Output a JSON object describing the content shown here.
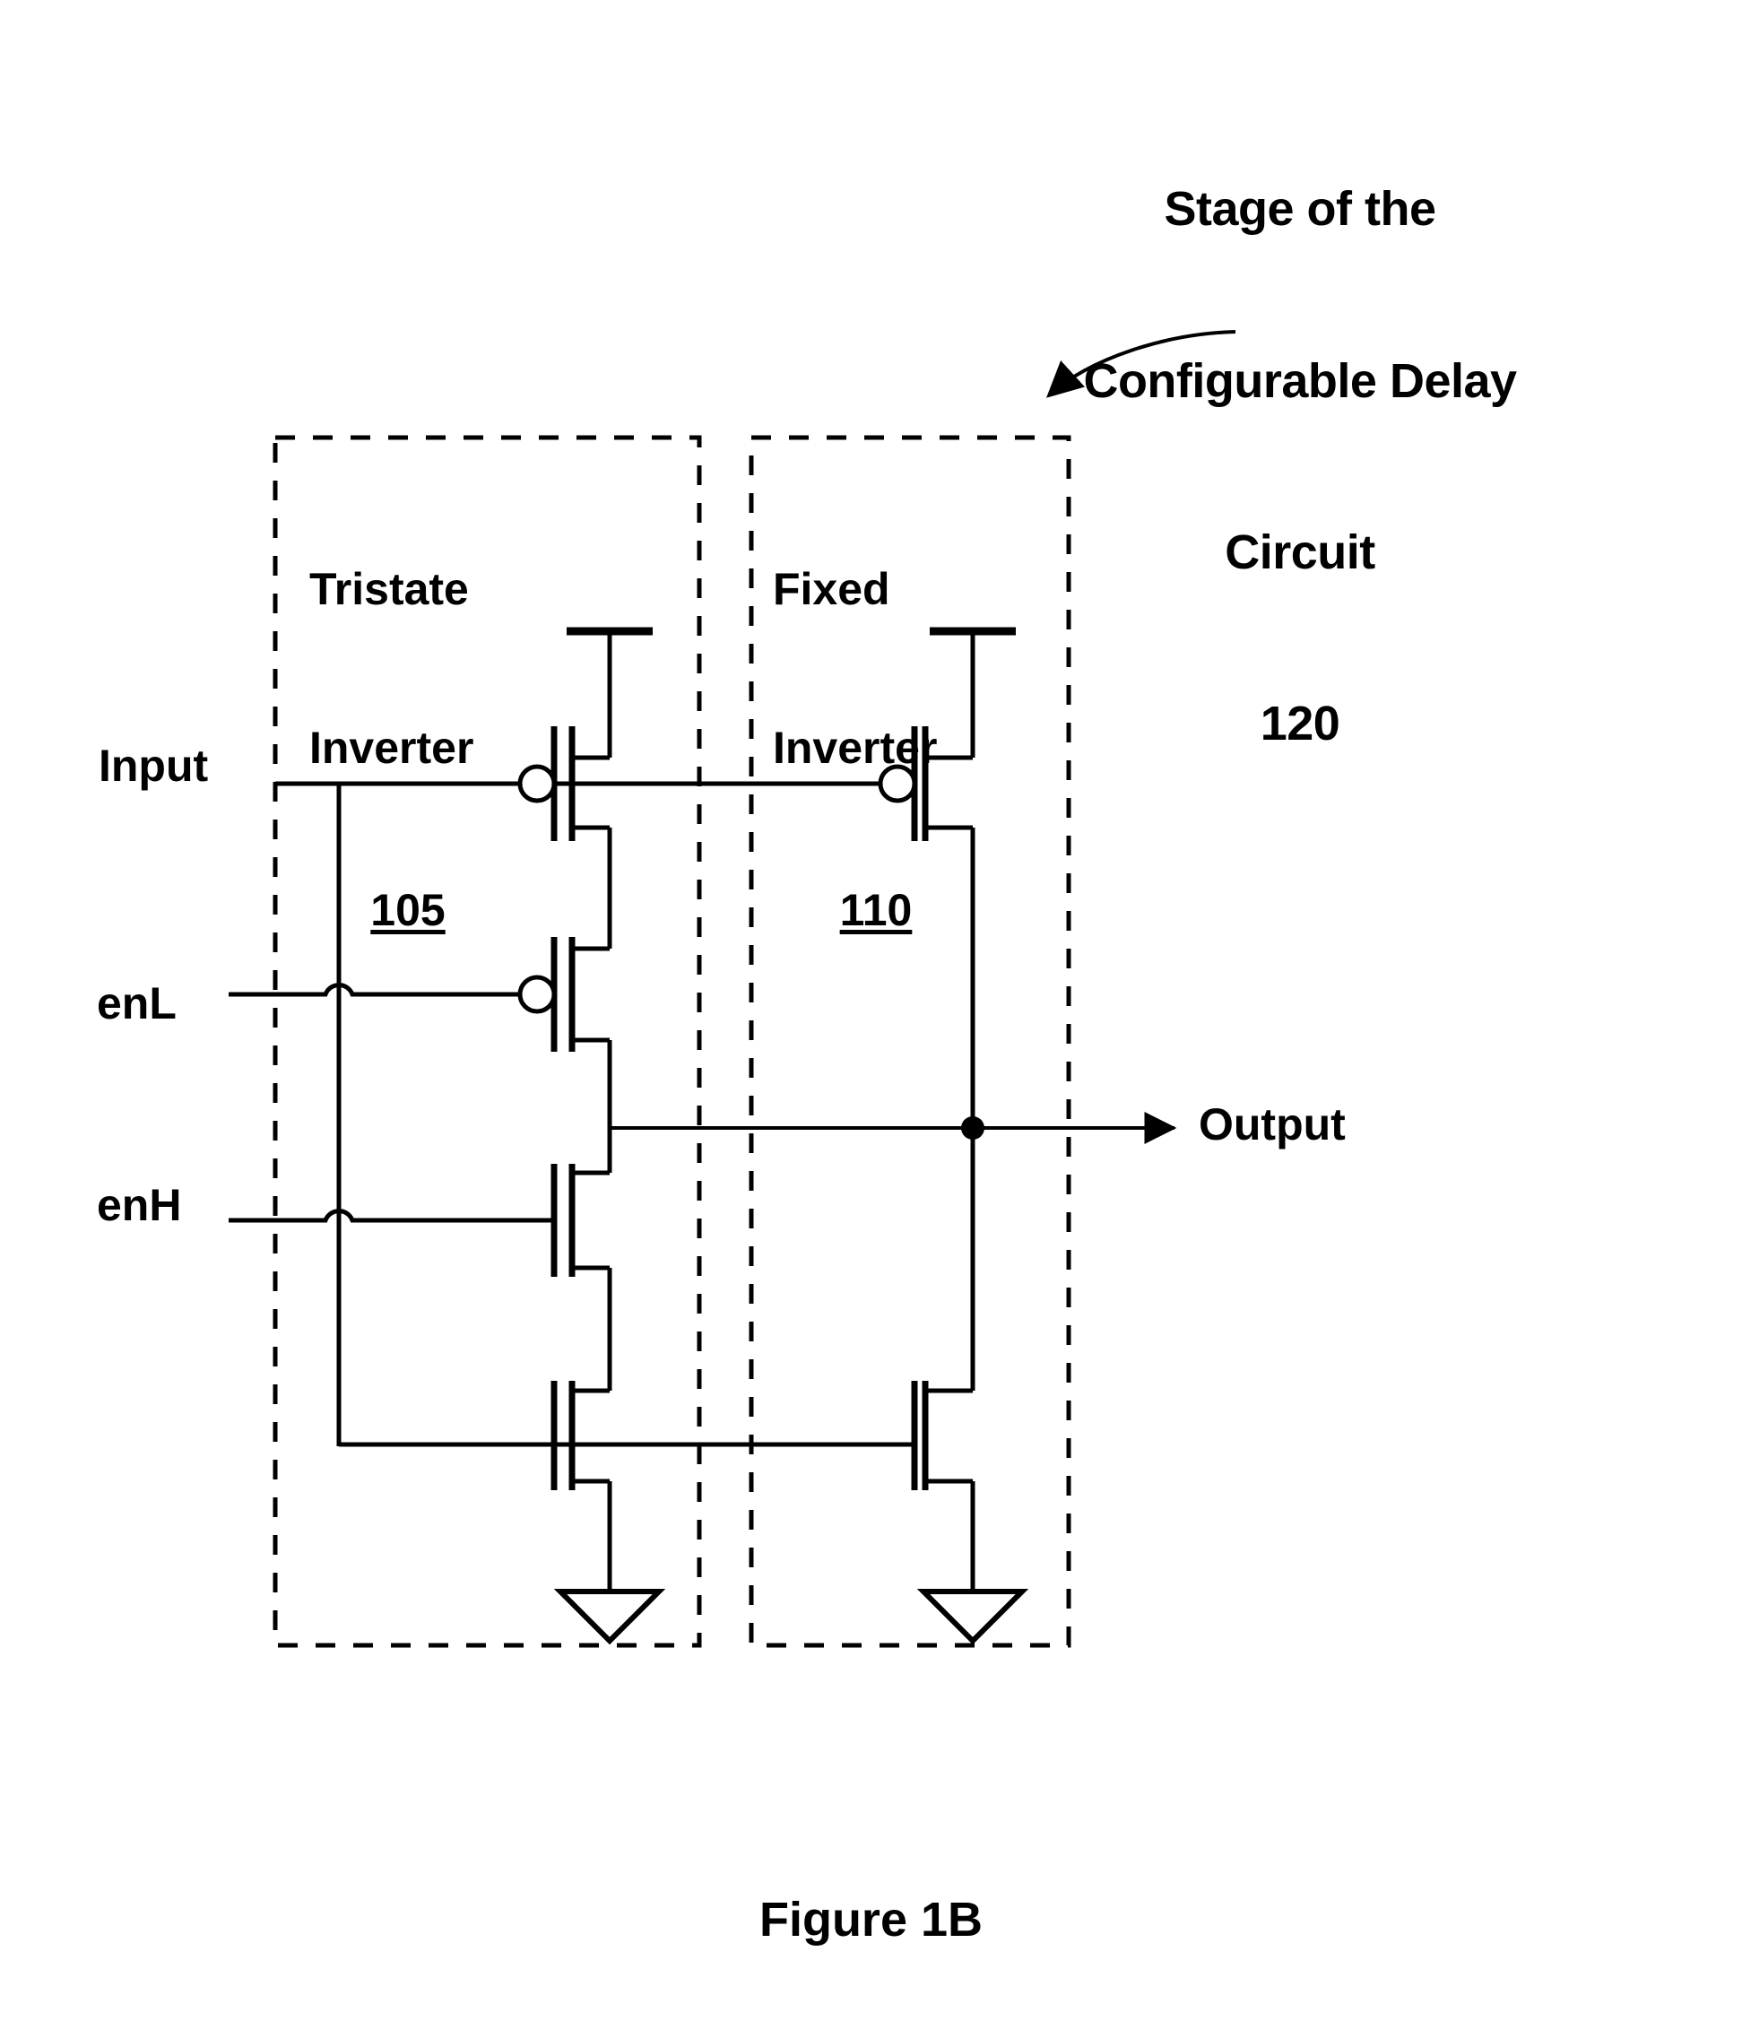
{
  "figure": {
    "caption": "Figure 1B",
    "callout": {
      "line1": "Stage of the",
      "line2": "Configurable Delay",
      "line3": "Circuit",
      "refnum": "120"
    }
  },
  "blocks": [
    {
      "id": "tristate-inverter",
      "title_line1": "Tristate",
      "title_line2": "Inverter",
      "refnum": "105"
    },
    {
      "id": "fixed-inverter",
      "title_line1": "Fixed",
      "title_line2": "Inverter",
      "refnum": "110"
    }
  ],
  "ports": {
    "input": "Input",
    "enable_low": "enL",
    "enable_high": "enH",
    "output": "Output"
  },
  "schematic": {
    "symbols": {
      "pmos": "pmos-transistor",
      "nmos": "nmos-transistor",
      "vdd": "vdd-supply-rail",
      "ground": "ground-triangle",
      "junction": "junction-dot",
      "wire_hop": "wire-crossover-hop",
      "arrowhead": "signal-arrowhead"
    },
    "colors": {
      "stroke": "#000000",
      "background": "#ffffff"
    },
    "stroke_widths": {
      "wire": 4,
      "device": 7,
      "dashed_box": 5
    }
  }
}
